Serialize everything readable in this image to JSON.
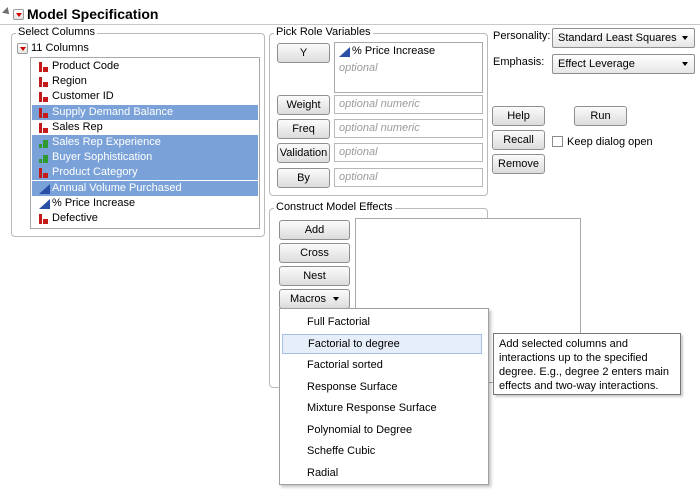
{
  "header": {
    "title": "Model Specification"
  },
  "select_columns": {
    "legend": "Select Columns",
    "count_label": "11 Columns",
    "columns": [
      {
        "name": "Product Code",
        "type": "nominal",
        "selected": false
      },
      {
        "name": "Region",
        "type": "nominal",
        "selected": false
      },
      {
        "name": "Customer ID",
        "type": "nominal",
        "selected": false
      },
      {
        "name": "Supply Demand Balance",
        "type": "nominal",
        "selected": true
      },
      {
        "name": "Sales Rep",
        "type": "nominal",
        "selected": false
      },
      {
        "name": "Sales Rep Experience",
        "type": "ordinal",
        "selected": true
      },
      {
        "name": "Buyer Sophistication",
        "type": "ordinal",
        "selected": true
      },
      {
        "name": "Product Category",
        "type": "nominal",
        "selected": true
      },
      {
        "name": "Annual Volume Purchased",
        "type": "continuous",
        "selected": true
      },
      {
        "name": "% Price Increase",
        "type": "continuous",
        "selected": false
      },
      {
        "name": "Defective",
        "type": "nominal",
        "selected": false
      }
    ]
  },
  "roles": {
    "legend": "Pick Role Variables",
    "y_label": "Y",
    "y_value": "% Price Increase",
    "y_placeholder": "optional",
    "weight_label": "Weight",
    "weight_placeholder": "optional numeric",
    "freq_label": "Freq",
    "freq_placeholder": "optional numeric",
    "validation_label": "Validation",
    "validation_placeholder": "optional",
    "by_label": "By",
    "by_placeholder": "optional"
  },
  "options": {
    "personality_label": "Personality:",
    "personality_value": "Standard Least Squares",
    "emphasis_label": "Emphasis:",
    "emphasis_value": "Effect Leverage",
    "help_label": "Help",
    "run_label": "Run",
    "recall_label": "Recall",
    "keep_open_label": "Keep dialog open",
    "keep_open_checked": false,
    "remove_label": "Remove"
  },
  "construct": {
    "legend": "Construct Model Effects",
    "add_label": "Add",
    "cross_label": "Cross",
    "nest_label": "Nest",
    "macros_label": "Macros"
  },
  "macros_menu": {
    "items": [
      "Full Factorial",
      "Factorial to degree",
      "Factorial sorted",
      "Response Surface",
      "Mixture Response Surface",
      "Polynomial to Degree",
      "Scheffe Cubic",
      "Radial"
    ],
    "highlighted": "Factorial to degree"
  },
  "tooltip": {
    "lines": [
      "Add selected columns and",
      "interactions up to the specified",
      "degree. E.g., degree 2 enters main",
      "effects and two-way interactions."
    ]
  },
  "colors": {
    "selection": "#7aa2d8",
    "nominal_icon": "#c41a1a",
    "ordinal_icon": "#2f9a2f",
    "continuous_icon": "#2a4fa5",
    "red_triangle": "#d10000"
  }
}
